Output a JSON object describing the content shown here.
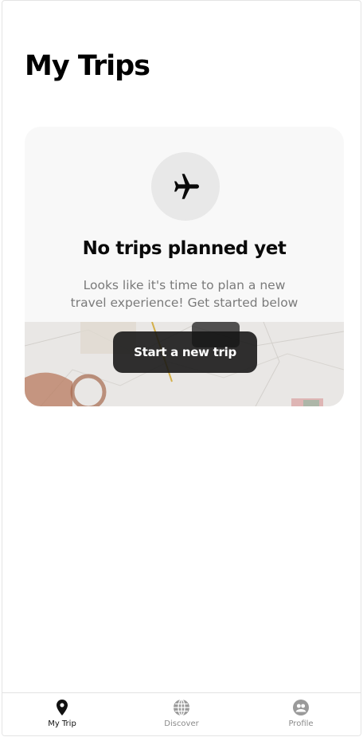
{
  "page": {
    "title": "My Trips"
  },
  "empty_state": {
    "icon": "airplane-icon",
    "title": "No trips planned yet",
    "description": "Looks like it's time to plan a new travel experience! Get started below",
    "button_label": "Start a new trip"
  },
  "bottom_nav": {
    "items": [
      {
        "label": "My Trip",
        "icon": "map-pin-icon",
        "active": true
      },
      {
        "label": "Discover",
        "icon": "globe-icon",
        "active": false
      },
      {
        "label": "Profile",
        "icon": "user-circle-icon",
        "active": false
      }
    ]
  },
  "colors": {
    "button_bg": "#141414",
    "card_bg": "#f8f8f8",
    "active_nav": "#111111",
    "inactive_nav": "#8a8a8a"
  }
}
